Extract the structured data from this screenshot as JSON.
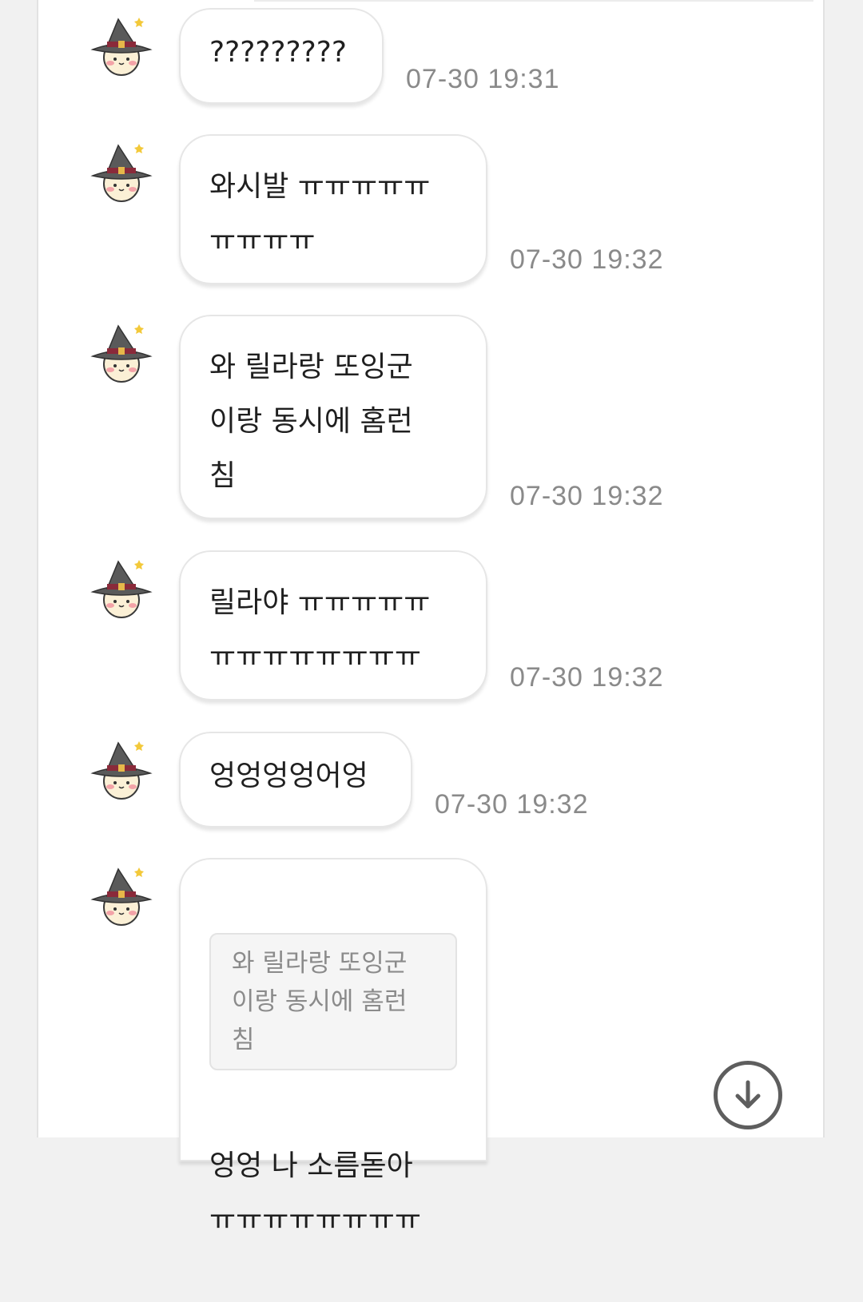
{
  "icons": {
    "avatar": "witch-hat-character-avatar-icon",
    "scroll": "arrow-down-circle-icon"
  },
  "colors": {
    "bubble_bg": "#ffffff",
    "bubble_border": "#e6e6e6",
    "timestamp": "#8a8a8a",
    "quote_bg": "#f5f5f5",
    "hat": "#5a5a5a",
    "hat_band": "#8a2a3a"
  },
  "messages": [
    {
      "text": "?????????",
      "time": "07-30 19:31"
    },
    {
      "text": "와시발 ㅠㅠㅠㅠㅠ\nㅠㅠㅠㅠ",
      "time": "07-30 19:32"
    },
    {
      "text": "와 릴라랑 또잉군\n이랑 동시에 홈런\n침",
      "time": "07-30 19:32"
    },
    {
      "text": "릴라야 ㅠㅠㅠㅠㅠ\nㅠㅠㅠㅠㅠㅠㅠㅠ",
      "time": "07-30 19:32"
    },
    {
      "text": "엉엉엉엉어엉",
      "time": "07-30 19:32"
    },
    {
      "quote": "와 릴라랑 또잉군\n이랑 동시에 홈런\n침",
      "text": "엉엉 나 소름돋아\nㅠㅠㅠㅠㅠㅠㅠㅠ"
    }
  ]
}
